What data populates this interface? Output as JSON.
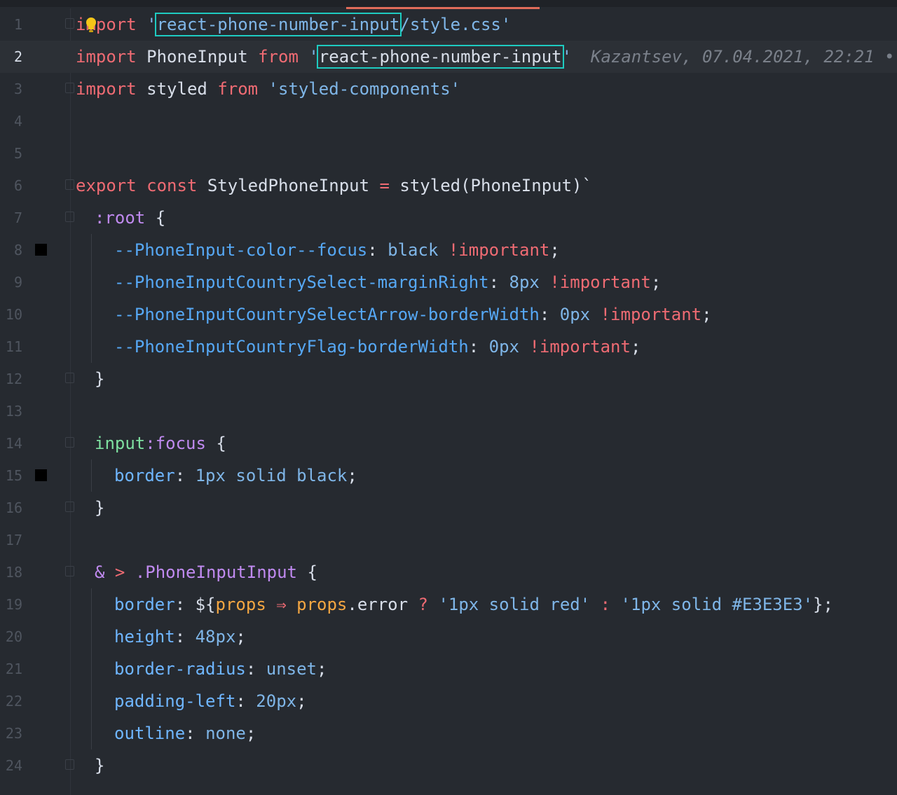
{
  "editor": {
    "lines": [
      {
        "n": "1"
      },
      {
        "n": "2"
      },
      {
        "n": "3"
      },
      {
        "n": "4"
      },
      {
        "n": "5"
      },
      {
        "n": "6"
      },
      {
        "n": "7"
      },
      {
        "n": "8"
      },
      {
        "n": "9"
      },
      {
        "n": "10"
      },
      {
        "n": "11"
      },
      {
        "n": "12"
      },
      {
        "n": "13"
      },
      {
        "n": "14"
      },
      {
        "n": "15"
      },
      {
        "n": "16"
      },
      {
        "n": "17"
      },
      {
        "n": "18"
      },
      {
        "n": "19"
      },
      {
        "n": "20"
      },
      {
        "n": "21"
      },
      {
        "n": "22"
      },
      {
        "n": "23"
      },
      {
        "n": "24"
      }
    ],
    "blame": "Kazantsev, 07.04.2021, 22:21 •",
    "code": {
      "l1": {
        "kw": "import",
        "q1": "'",
        "hl": "react-phone-number-input",
        "rest": "/style.css'"
      },
      "l2": {
        "kw": "import",
        "id": "PhoneInput",
        "from": "from",
        "q1": "'",
        "hl": "react-phone-number-input",
        "q2": "'"
      },
      "l3": {
        "kw": "import",
        "id": "styled",
        "from": "from",
        "str": "'styled-components'"
      },
      "l6": {
        "kw1": "export",
        "kw2": "const",
        "id": "StyledPhoneInput",
        "eq": "=",
        "call": "styled(PhoneInput)`"
      },
      "l7": {
        "sel": ":root",
        "brace": "{"
      },
      "l8": {
        "var": "--PhoneInput-color--focus",
        "colon": ":",
        "val": "black",
        "imp": "!important",
        "semi": ";"
      },
      "l9": {
        "var": "--PhoneInputCountrySelect-marginRight",
        "colon": ":",
        "val": "8px",
        "imp": "!important",
        "semi": ";"
      },
      "l10": {
        "var": "--PhoneInputCountrySelectArrow-borderWidth",
        "colon": ":",
        "val": "0px",
        "imp": "!important",
        "semi": ";"
      },
      "l11": {
        "var": "--PhoneInputCountryFlag-borderWidth",
        "colon": ":",
        "val": "0px",
        "imp": "!important",
        "semi": ";"
      },
      "l12": {
        "brace": "}"
      },
      "l14": {
        "tag": "input",
        "pseudo": ":focus",
        "brace": "{"
      },
      "l15": {
        "prop": "border",
        "colon": ":",
        "val": "1px solid black",
        "semi": ";"
      },
      "l16": {
        "brace": "}"
      },
      "l18": {
        "amp": "&",
        "gt": ">",
        "cls": ".PhoneInputInput",
        "brace": "{"
      },
      "l19": {
        "prop": "border",
        "colon": ":",
        "open": "${",
        "arg": "props",
        "arrow": "⇒",
        "arg2": "props",
        "member": ".error",
        "q": "?",
        "s1": "'1px solid red'",
        "c": ":",
        "s2": "'1px solid #E3E3E3'",
        "close": "};"
      },
      "l20": {
        "prop": "height",
        "colon": ":",
        "val": "48px",
        "semi": ";"
      },
      "l21": {
        "prop": "border-radius",
        "colon": ":",
        "val": "unset",
        "semi": ";"
      },
      "l22": {
        "prop": "padding-left",
        "colon": ":",
        "val": "20px",
        "semi": ";"
      },
      "l23": {
        "prop": "outline",
        "colon": ":",
        "val": "none",
        "semi": ";"
      },
      "l24": {
        "brace": "}"
      }
    }
  },
  "colors": {
    "background": "#262a30",
    "keyword": "#ef6b73",
    "string": "#7fb6e8",
    "highlight_border": "#1ecbc1",
    "active_tab": "#e06c5a"
  }
}
